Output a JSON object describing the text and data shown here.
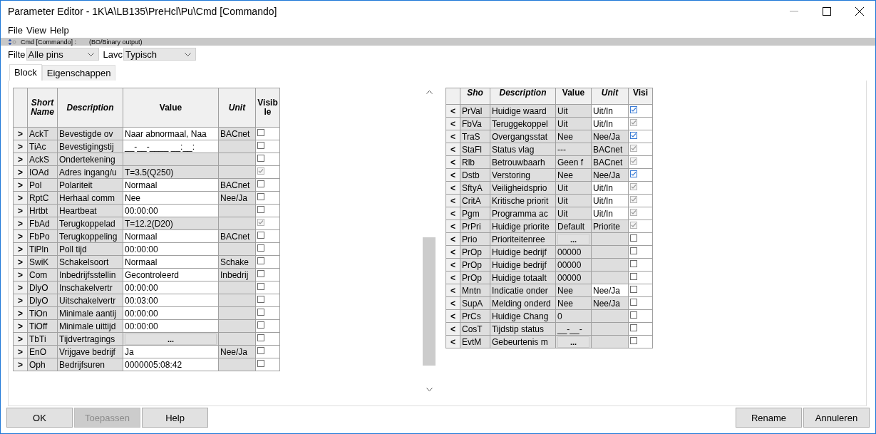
{
  "window": {
    "title": "Parameter Editor - 1K\\A\\LB135\\PreHcl\\Pu\\Cmd [Commando]"
  },
  "menu": [
    "File",
    "View",
    "Help"
  ],
  "info_bar": {
    "name": "Cmd [Commando] :",
    "type": "(BO/Binary output)"
  },
  "filters": [
    {
      "label": "Filte",
      "value": "Alle pins"
    },
    {
      "label": "Lavc",
      "value": "Typisch"
    }
  ],
  "tabs": [
    {
      "label": "Block",
      "selected": true
    },
    {
      "label": "Eigenschappen",
      "selected": false
    }
  ],
  "left_table": {
    "columns": [
      {
        "label": "Short Name",
        "italic": true
      },
      {
        "label": "Description",
        "italic": true
      },
      {
        "label": "Value",
        "italic": false
      },
      {
        "label": "Unit",
        "italic": true
      },
      {
        "label": "Visible",
        "italic": false
      }
    ],
    "rows": [
      {
        "arrow": ">",
        "short": "AckT",
        "description": "Bevestigde ov",
        "value": "Naar abnormaal, Naa",
        "kind": "text",
        "value_editable": true,
        "unit": "BACnet",
        "unit_editable": false,
        "checked": false,
        "disabled": false
      },
      {
        "arrow": ">",
        "short": "TiAc",
        "description": "Bevestigingstij",
        "value": "__-__-____   __:__:",
        "kind": "text",
        "value_editable": true,
        "unit": "",
        "unit_editable": false,
        "checked": false,
        "disabled": false
      },
      {
        "arrow": ">",
        "short": "AckS",
        "description": "Ondertekening",
        "value": "",
        "kind": "text",
        "value_editable": false,
        "unit": "",
        "unit_editable": false,
        "checked": false,
        "disabled": false
      },
      {
        "arrow": ">",
        "short": "IOAd",
        "description": "Adres ingang/u",
        "value": "T=3.5(Q250)",
        "kind": "text",
        "value_editable": false,
        "unit": "",
        "unit_editable": false,
        "checked": true,
        "disabled": true
      },
      {
        "arrow": ">",
        "short": "Pol",
        "description": "Polariteit",
        "value": "Normaal",
        "kind": "text",
        "value_editable": true,
        "unit": "BACnet",
        "unit_editable": false,
        "checked": false,
        "disabled": false
      },
      {
        "arrow": ">",
        "short": "RptC",
        "description": "Herhaal comm",
        "value": "Nee",
        "kind": "text",
        "value_editable": true,
        "unit": "Nee/Ja",
        "unit_editable": false,
        "checked": false,
        "disabled": false
      },
      {
        "arrow": ">",
        "short": "Hrtbt",
        "description": "Heartbeat",
        "value": "00:00:00",
        "kind": "text",
        "value_editable": true,
        "unit": "",
        "unit_editable": false,
        "checked": false,
        "disabled": false
      },
      {
        "arrow": ">",
        "short": "FbAd",
        "description": "Terugkoppelad",
        "value": "T=12.2(D20)",
        "kind": "text",
        "value_editable": false,
        "unit": "",
        "unit_editable": false,
        "checked": true,
        "disabled": true
      },
      {
        "arrow": ">",
        "short": "FbPo",
        "description": "Terugkoppeling",
        "value": "Normaal",
        "kind": "text",
        "value_editable": true,
        "unit": "BACnet",
        "unit_editable": false,
        "checked": false,
        "disabled": false
      },
      {
        "arrow": ">",
        "short": "TiPln",
        "description": "Poll tijd",
        "value": "00:00:00",
        "kind": "text",
        "value_editable": true,
        "unit": "",
        "unit_editable": false,
        "checked": false,
        "disabled": false
      },
      {
        "arrow": ">",
        "short": "SwiK",
        "description": "Schakelsoort",
        "value": "Normaal",
        "kind": "text",
        "value_editable": true,
        "unit": "Schake",
        "unit_editable": false,
        "checked": false,
        "disabled": false
      },
      {
        "arrow": ">",
        "short": "Com",
        "description": "Inbedrijfsstellin",
        "value": "Gecontroleerd",
        "kind": "text",
        "value_editable": true,
        "unit": "Inbedrij",
        "unit_editable": false,
        "checked": false,
        "disabled": false
      },
      {
        "arrow": ">",
        "short": "DlyO",
        "description": "Inschakelvertr",
        "value": "00:00:00",
        "kind": "text",
        "value_editable": true,
        "unit": "",
        "unit_editable": false,
        "checked": false,
        "disabled": false
      },
      {
        "arrow": ">",
        "short": "DlyO",
        "description": "Uitschakelvertr",
        "value": "00:03:00",
        "kind": "text",
        "value_editable": true,
        "unit": "",
        "unit_editable": false,
        "checked": false,
        "disabled": false
      },
      {
        "arrow": ">",
        "short": "TiOn",
        "description": "Minimale aantij",
        "value": "00:00:00",
        "kind": "text",
        "value_editable": true,
        "unit": "",
        "unit_editable": false,
        "checked": false,
        "disabled": false
      },
      {
        "arrow": ">",
        "short": "TiOff",
        "description": "Minimale uittijd",
        "value": "00:00:00",
        "kind": "text",
        "value_editable": true,
        "unit": "",
        "unit_editable": false,
        "checked": false,
        "disabled": false
      },
      {
        "arrow": ">",
        "short": "TbTi",
        "description": "Tijdvertragings",
        "value": "...",
        "kind": "button",
        "value_editable": false,
        "unit": "",
        "unit_editable": false,
        "checked": false,
        "disabled": false
      },
      {
        "arrow": ">",
        "short": "EnO",
        "description": "Vrijgave bedrijf",
        "value": "Ja",
        "kind": "text",
        "value_editable": true,
        "unit": "Nee/Ja",
        "unit_editable": false,
        "checked": false,
        "disabled": false
      },
      {
        "arrow": ">",
        "short": "Oph",
        "description": "Bedrijfsuren",
        "value": "0000005:08:42",
        "kind": "text",
        "value_editable": true,
        "unit": "",
        "unit_editable": false,
        "checked": false,
        "disabled": false
      }
    ]
  },
  "right_table": {
    "columns": [
      {
        "label": "Sho",
        "italic": true
      },
      {
        "label": "Description",
        "italic": true
      },
      {
        "label": "Value",
        "italic": false
      },
      {
        "label": "Unit",
        "italic": true
      },
      {
        "label": "Visi",
        "italic": false
      }
    ],
    "rows": [
      {
        "arrow": "<",
        "short": "PrVal",
        "description": "Huidige waard",
        "value": "Uit",
        "kind": "text",
        "value_editable": false,
        "unit": "Uit/In",
        "unit_editable": true,
        "checked": true,
        "disabled": false
      },
      {
        "arrow": "<",
        "short": "FbVa",
        "description": "Teruggekoppel",
        "value": "Uit",
        "kind": "text",
        "value_editable": false,
        "unit": "Uit/In",
        "unit_editable": true,
        "checked": true,
        "disabled": true
      },
      {
        "arrow": "<",
        "short": "TraS",
        "description": "Overgangsstat",
        "value": "Nee",
        "kind": "text",
        "value_editable": false,
        "unit": "Nee/Ja",
        "unit_editable": false,
        "checked": true,
        "disabled": false
      },
      {
        "arrow": "<",
        "short": "StaFl",
        "description": "Status vlag",
        "value": "---",
        "kind": "text",
        "value_editable": false,
        "unit": "BACnet",
        "unit_editable": false,
        "checked": true,
        "disabled": true
      },
      {
        "arrow": "<",
        "short": "Rlb",
        "description": "Betrouwbaarh",
        "value": "Geen f",
        "kind": "text",
        "value_editable": false,
        "unit": "BACnet",
        "unit_editable": false,
        "checked": true,
        "disabled": true
      },
      {
        "arrow": "<",
        "short": "Dstb",
        "description": "Verstoring",
        "value": "Nee",
        "kind": "text",
        "value_editable": false,
        "unit": "Nee/Ja",
        "unit_editable": false,
        "checked": true,
        "disabled": false
      },
      {
        "arrow": "<",
        "short": "SftyA",
        "description": "Veiligheidsprio",
        "value": "Uit",
        "kind": "text",
        "value_editable": false,
        "unit": "Uit/In",
        "unit_editable": true,
        "checked": true,
        "disabled": true
      },
      {
        "arrow": "<",
        "short": "CritA",
        "description": "Kritische priorit",
        "value": "Uit",
        "kind": "text",
        "value_editable": false,
        "unit": "Uit/In",
        "unit_editable": true,
        "checked": true,
        "disabled": true
      },
      {
        "arrow": "<",
        "short": "Pgm",
        "description": "Programma ac",
        "value": "Uit",
        "kind": "text",
        "value_editable": false,
        "unit": "Uit/In",
        "unit_editable": true,
        "checked": true,
        "disabled": true
      },
      {
        "arrow": "<",
        "short": "PrPri",
        "description": "Huidige priorite",
        "value": "Default",
        "kind": "text",
        "value_editable": false,
        "unit": "Priorite",
        "unit_editable": false,
        "checked": true,
        "disabled": true
      },
      {
        "arrow": "<",
        "short": "Prio",
        "description": "Prioriteitenree",
        "value": "...",
        "kind": "button",
        "value_editable": false,
        "unit": "",
        "unit_editable": false,
        "checked": false,
        "disabled": false
      },
      {
        "arrow": "<",
        "short": "PrOp",
        "description": "Huidige bedrijf",
        "value": "00000",
        "kind": "text",
        "value_editable": false,
        "unit": "",
        "unit_editable": false,
        "checked": false,
        "disabled": false
      },
      {
        "arrow": "<",
        "short": "PrOp",
        "description": "Huidige bedrijf",
        "value": "00000",
        "kind": "text",
        "value_editable": false,
        "unit": "",
        "unit_editable": false,
        "checked": false,
        "disabled": false
      },
      {
        "arrow": "<",
        "short": "PrOp",
        "description": "Huidige totaalt",
        "value": "00000",
        "kind": "text",
        "value_editable": false,
        "unit": "",
        "unit_editable": false,
        "checked": false,
        "disabled": false
      },
      {
        "arrow": "<",
        "short": "Mntn",
        "description": "Indicatie onder",
        "value": "Nee",
        "kind": "text",
        "value_editable": false,
        "unit": "Nee/Ja",
        "unit_editable": true,
        "checked": false,
        "disabled": false
      },
      {
        "arrow": "<",
        "short": "SupA",
        "description": "Melding onderd",
        "value": "Nee",
        "kind": "text",
        "value_editable": false,
        "unit": "Nee/Ja",
        "unit_editable": false,
        "checked": false,
        "disabled": false
      },
      {
        "arrow": "<",
        "short": "PrCs",
        "description": "Huidige Chang",
        "value": "0",
        "kind": "text",
        "value_editable": false,
        "unit": "",
        "unit_editable": false,
        "checked": false,
        "disabled": false
      },
      {
        "arrow": "<",
        "short": "CosT",
        "description": "Tijdstip status",
        "value": "__-__-",
        "kind": "text",
        "value_editable": false,
        "unit": "",
        "unit_editable": false,
        "checked": false,
        "disabled": false
      },
      {
        "arrow": "<",
        "short": "EvtM",
        "description": "Gebeurtenis m",
        "value": "...",
        "kind": "button",
        "value_editable": false,
        "unit": "",
        "unit_editable": false,
        "checked": false,
        "disabled": false
      }
    ]
  },
  "buttons_left": [
    {
      "label": "OK",
      "disabled": false
    },
    {
      "label": "Toepassen",
      "disabled": true
    },
    {
      "label": "Help",
      "disabled": false
    }
  ],
  "buttons_right": [
    {
      "label": "Rename",
      "disabled": false
    },
    {
      "label": "Annuleren",
      "disabled": false
    }
  ]
}
